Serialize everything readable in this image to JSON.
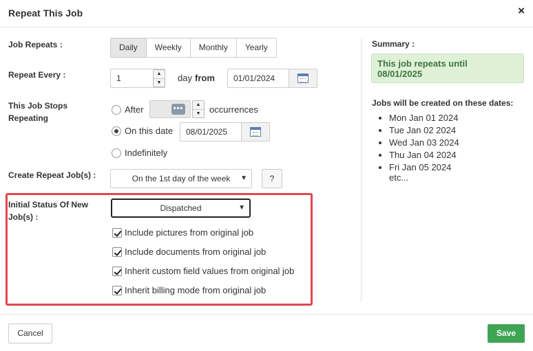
{
  "dialog": {
    "title": "Repeat This Job",
    "close_glyph": "×"
  },
  "form": {
    "job_repeats": {
      "label": "Job Repeats :",
      "options": [
        "Daily",
        "Weekly",
        "Monthly",
        "Yearly"
      ],
      "selected": "Daily"
    },
    "repeat_every": {
      "label": "Repeat Every :",
      "value": "1",
      "unit_text": "day",
      "from_text": "from",
      "from_date": "01/01/2024"
    },
    "stops": {
      "label_line1": "This Job Stops",
      "label_line2": "Repeating",
      "after_label": "After",
      "occurrences_text": "occurrences",
      "on_date_label": "On this date",
      "on_date_value": "08/01/2025",
      "indefinitely_label": "Indefinitely",
      "selected": "On this date"
    },
    "create_repeat": {
      "label": "Create Repeat Job(s) :",
      "selected": "On the 1st day of the week",
      "help_label": "?"
    },
    "initial_status": {
      "label_line1": "Initial Status Of New",
      "label_line2": "Job(s) :",
      "selected": "Dispatched"
    },
    "checkboxes": [
      {
        "label": "Include pictures from original job",
        "checked": true
      },
      {
        "label": "Include documents from original job",
        "checked": true
      },
      {
        "label": "Inherit custom field values from original job",
        "checked": true
      },
      {
        "label": "Inherit billing mode from original job",
        "checked": true
      }
    ]
  },
  "summary": {
    "heading": "Summary :",
    "message_line1": "This job repeats until",
    "message_line2": "08/01/2025",
    "dates_heading": "Jobs will be created on these dates:",
    "dates": [
      "Mon Jan 01 2024",
      "Tue Jan 02 2024",
      "Wed Jan 03 2024",
      "Thu Jan 04 2024",
      "Fri Jan 05 2024"
    ],
    "more": "etc..."
  },
  "footer": {
    "cancel_label": "Cancel",
    "save_label": "Save"
  },
  "colors": {
    "save": "#3fa556",
    "highlight": "#e0474c",
    "summary_bg": "#dff0d8",
    "summary_text": "#3c763d"
  }
}
